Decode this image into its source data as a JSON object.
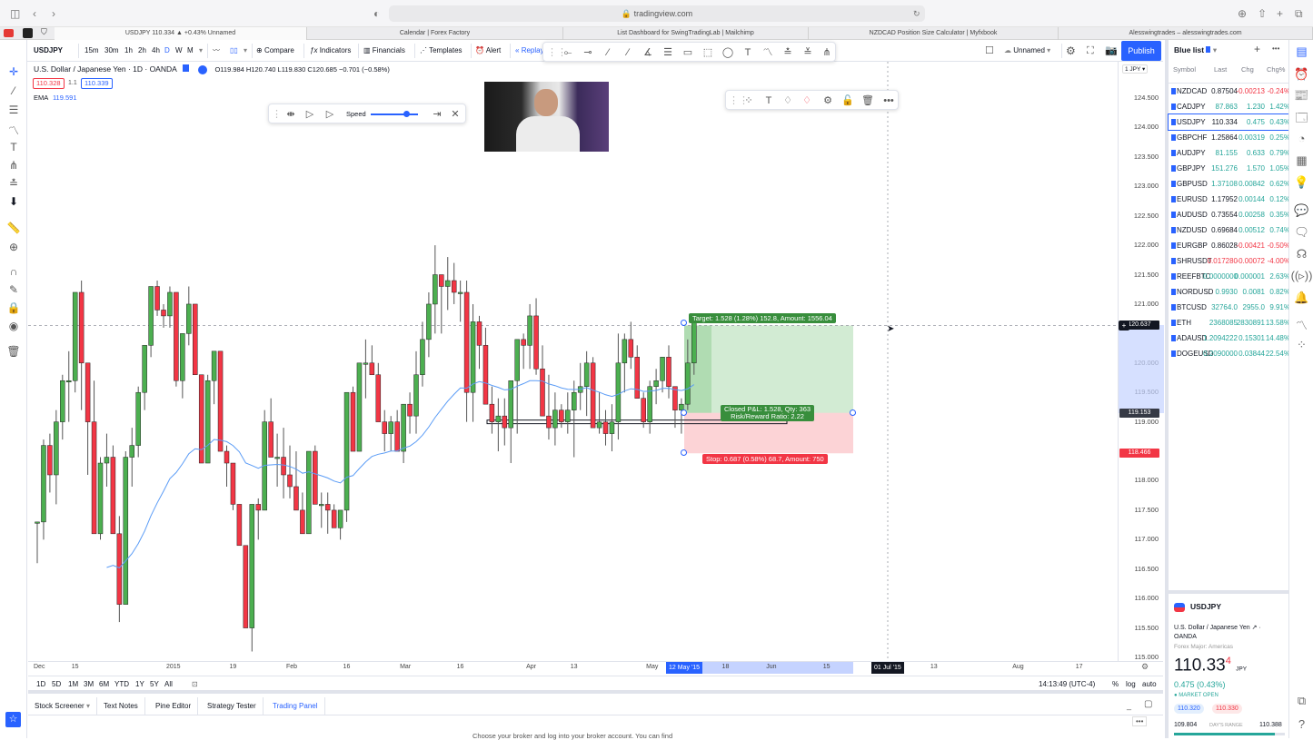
{
  "browser": {
    "url": "tradingview.com",
    "tabs": [
      {
        "label": "USDJPY 110.334 ▲ +0.43% Unnamed",
        "active": true
      },
      {
        "label": "Calendar | Forex Factory",
        "active": false
      },
      {
        "label": "List Dashboard for SwingTradingLab | Mailchimp",
        "active": false
      },
      {
        "label": "NZDCAD Position Size Calculator | Myfxbook",
        "active": false
      },
      {
        "label": "Alesswingtrades – alesswingtrades.com",
        "active": false
      }
    ]
  },
  "toolbar": {
    "symbol": "USDJPY",
    "intervals": [
      "15m",
      "30m",
      "1h",
      "2h",
      "4h",
      "D",
      "W",
      "M"
    ],
    "active_interval": "D",
    "compare": "Compare",
    "indicators": "Indicators",
    "financials": "Financials",
    "templates": "Templates",
    "alert": "Alert",
    "replay": "Replay",
    "layout_name": "Unnamed",
    "publish": "Publish"
  },
  "legend": {
    "title": "U.S. Dollar / Japanese Yen · 1D · OANDA",
    "ohlc": "O119.984 H120.740 L119.830 C120.685 −0.701 (−0.58%)",
    "bid": "110.328",
    "spread": "1.1",
    "ask": "110.339",
    "ema_label": "EMA",
    "ema_value": "119.591"
  },
  "replay_bar": {
    "speed_label": "Speed",
    "speed": 0.75
  },
  "position_tool": {
    "target_label": "Target: 1.528 (1.28%) 152.8, Amount: 1556.04",
    "closed_label_1": "Closed P&L: 1.528, Qty: 363",
    "closed_label_2": "Risk/Reward Ratio: 2.22",
    "stop_label": "Stop: 0.687 (0.58%) 68.7, Amount: 750"
  },
  "chart_data": {
    "type": "candlestick",
    "title": "USDJPY · 1D · OANDA",
    "ylim": [
      115.0,
      124.75
    ],
    "y_ticks": [
      "124.500",
      "124.000",
      "123.500",
      "123.000",
      "122.500",
      "122.000",
      "121.500",
      "121.000",
      "120.000",
      "119.500",
      "119.000",
      "118.000",
      "117.500",
      "117.000",
      "116.500",
      "116.000",
      "115.500",
      "115.000"
    ],
    "y_tick_values": [
      124.5,
      124.0,
      123.5,
      123.0,
      122.5,
      122.0,
      121.5,
      121.0,
      120.0,
      119.5,
      119.0,
      118.0,
      117.5,
      117.0,
      116.5,
      116.0,
      115.5,
      115.0
    ],
    "price_badges": [
      {
        "value": "120.637",
        "color": "#131722"
      },
      {
        "value": "119.153",
        "color": "#363a45"
      },
      {
        "value": "118.466",
        "color": "#f23645"
      }
    ],
    "currency_label": "1 JPY ▾",
    "x_ticks": [
      "Dec",
      "15",
      "2015",
      "19",
      "Feb",
      "16",
      "Mar",
      "16",
      "Apr",
      "13",
      "May",
      "18",
      "Jun",
      "15",
      "13",
      "Aug",
      "17"
    ],
    "x_tick_index": [
      0,
      6,
      21,
      31,
      40,
      49,
      58,
      67,
      78,
      85,
      97,
      109,
      116,
      125,
      142,
      155,
      165
    ],
    "x_highlight_start": "12 May '15",
    "x_highlight_end": "01 Jul '15",
    "candles": [
      [
        117.3,
        117.3,
        116.6,
        117.3
      ],
      [
        117.3,
        118.7,
        117.0,
        118.6
      ],
      [
        118.6,
        118.8,
        117.8,
        118.1
      ],
      [
        118.1,
        119.2,
        117.6,
        119.0
      ],
      [
        119.0,
        119.8,
        118.7,
        119.7
      ],
      [
        119.7,
        120.2,
        119.0,
        119.7
      ],
      [
        119.7,
        121.1,
        119.5,
        121.2
      ],
      [
        121.2,
        121.4,
        119.2,
        120.0
      ],
      [
        120.0,
        119.5,
        118.1,
        119.0
      ],
      [
        119.0,
        119.7,
        117.4,
        117.1
      ],
      [
        117.1,
        118.4,
        117.0,
        118.3
      ],
      [
        118.3,
        118.8,
        117.9,
        118.4
      ],
      [
        118.4,
        118.6,
        117.1,
        117.1
      ],
      [
        117.1,
        117.4,
        115.6,
        115.9
      ],
      [
        115.9,
        118.5,
        115.9,
        118.4
      ],
      [
        118.4,
        118.9,
        117.9,
        118.6
      ],
      [
        118.6,
        119.6,
        118.4,
        119.5
      ],
      [
        119.5,
        120.2,
        119.2,
        120.3
      ],
      [
        120.3,
        121.0,
        120.1,
        121.3
      ],
      [
        121.3,
        121.4,
        120.8,
        120.9
      ],
      [
        120.9,
        121.0,
        120.6,
        120.8
      ],
      [
        120.8,
        121.3,
        120.6,
        121.2
      ],
      [
        121.2,
        121.2,
        119.6,
        119.7
      ],
      [
        119.7,
        120.5,
        119.4,
        120.5
      ],
      [
        120.5,
        121.3,
        120.3,
        121.0
      ],
      [
        121.0,
        121.0,
        119.8,
        119.8
      ],
      [
        119.8,
        119.8,
        118.4,
        118.3
      ],
      [
        118.3,
        119.8,
        118.3,
        119.7
      ],
      [
        119.7,
        120.2,
        119.3,
        120.2
      ],
      [
        120.2,
        120.2,
        118.5,
        118.5
      ],
      [
        118.5,
        118.6,
        117.9,
        118.3
      ],
      [
        118.3,
        118.3,
        117.5,
        117.6
      ],
      [
        117.6,
        117.6,
        116.9,
        116.9
      ],
      [
        116.9,
        116.9,
        115.6,
        115.5
      ],
      [
        115.5,
        117.5,
        115.1,
        117.6
      ],
      [
        117.6,
        117.7,
        117.0,
        117.5
      ],
      [
        117.5,
        119.2,
        117.5,
        119.0
      ],
      [
        119.0,
        119.4,
        118.6,
        118.4
      ],
      [
        118.4,
        118.8,
        117.9,
        118.4
      ],
      [
        118.4,
        118.9,
        117.7,
        118.1
      ],
      [
        118.1,
        118.6,
        117.7,
        117.9
      ],
      [
        117.9,
        118.5,
        117.5,
        117.5
      ],
      [
        117.5,
        117.8,
        117.3,
        117.1
      ],
      [
        117.1,
        118.4,
        117.3,
        118.5
      ],
      [
        118.5,
        118.6,
        117.9,
        117.6
      ],
      [
        117.6,
        117.8,
        117.2,
        117.6
      ],
      [
        117.6,
        117.8,
        117.1,
        117.5
      ],
      [
        117.5,
        117.6,
        117.3,
        117.2
      ],
      [
        117.2,
        117.4,
        117.0,
        117.5
      ],
      [
        117.5,
        119.5,
        117.3,
        119.5
      ],
      [
        119.5,
        119.6,
        118.6,
        118.5
      ],
      [
        118.5,
        120.0,
        118.5,
        120.0
      ],
      [
        120.0,
        120.4,
        119.4,
        120.0
      ],
      [
        120.0,
        120.3,
        119.8,
        119.8
      ],
      [
        119.8,
        120.0,
        119.3,
        119.0
      ],
      [
        119.0,
        119.2,
        118.5,
        118.8
      ],
      [
        118.8,
        119.1,
        118.5,
        119.0
      ],
      [
        119.0,
        119.2,
        118.7,
        118.5
      ],
      [
        118.5,
        119.2,
        118.3,
        119.3
      ],
      [
        119.3,
        119.5,
        118.8,
        119.1
      ],
      [
        119.1,
        120.2,
        118.8,
        119.8
      ],
      [
        119.8,
        120.7,
        119.6,
        120.4
      ],
      [
        120.4,
        121.2,
        120.1,
        121.0
      ],
      [
        121.0,
        122.0,
        120.5,
        121.5
      ],
      [
        121.5,
        121.5,
        120.5,
        121.3
      ],
      [
        121.3,
        121.8,
        120.9,
        121.4
      ],
      [
        121.4,
        121.7,
        121.0,
        121.2
      ],
      [
        121.2,
        121.4,
        120.7,
        121.2
      ],
      [
        121.2,
        121.4,
        119.0,
        119.5
      ],
      [
        119.5,
        121.0,
        119.0,
        120.7
      ],
      [
        120.7,
        120.8,
        119.9,
        120.3
      ],
      [
        120.3,
        120.6,
        119.5,
        119.3
      ],
      [
        119.3,
        119.6,
        118.8,
        119.0
      ],
      [
        119.0,
        119.4,
        118.5,
        119.1
      ],
      [
        119.1,
        119.4,
        118.6,
        118.9
      ],
      [
        118.9,
        119.1,
        118.3,
        119.7
      ],
      [
        119.7,
        119.9,
        118.8,
        120.4
      ],
      [
        120.4,
        120.5,
        119.9,
        120.3
      ],
      [
        120.3,
        121.0,
        119.9,
        120.8
      ],
      [
        120.8,
        121.1,
        119.8,
        119.9
      ],
      [
        119.9,
        120.3,
        119.5,
        119.1
      ],
      [
        119.1,
        119.8,
        118.7,
        118.9
      ],
      [
        118.9,
        119.5,
        118.6,
        119.2
      ],
      [
        119.2,
        119.3,
        118.9,
        119.0
      ],
      [
        119.0,
        119.5,
        118.8,
        119.2
      ],
      [
        119.2,
        119.7,
        118.4,
        119.5
      ],
      [
        119.5,
        120.0,
        119.2,
        119.6
      ],
      [
        119.6,
        120.2,
        119.1,
        120.0
      ],
      [
        120.0,
        120.1,
        119.5,
        118.9
      ],
      [
        118.9,
        119.5,
        118.8,
        119.0
      ],
      [
        119.0,
        119.2,
        118.6,
        118.8
      ],
      [
        118.8,
        119.3,
        118.5,
        119.0
      ],
      [
        119.0,
        120.5,
        118.7,
        120.0
      ],
      [
        120.0,
        120.5,
        119.5,
        120.4
      ],
      [
        120.4,
        120.7,
        119.9,
        120.1
      ],
      [
        120.1,
        120.3,
        119.4,
        119.4
      ],
      [
        119.4,
        119.5,
        118.9,
        119.0
      ],
      [
        119.0,
        119.7,
        118.8,
        119.6
      ],
      [
        119.6,
        119.9,
        119.3,
        119.7
      ],
      [
        119.7,
        120.1,
        119.5,
        120.1
      ],
      [
        120.1,
        120.3,
        119.4,
        119.6
      ],
      [
        119.6,
        119.6,
        118.9,
        119.2
      ],
      [
        119.2,
        119.4,
        118.8,
        119.3
      ],
      [
        119.3,
        120.4,
        119.2,
        120.0
      ],
      [
        120.0,
        120.7,
        119.8,
        120.7
      ]
    ],
    "ema_color": "#5b9cf6",
    "up_color": "#4caf50",
    "down_color": "#f23645"
  },
  "timebar": {
    "ranges": [
      "1D",
      "5D",
      "1M",
      "3M",
      "6M",
      "YTD",
      "1Y",
      "5Y",
      "All"
    ],
    "clock": "14:13:49 (UTC-4)",
    "pct": "%",
    "log": "log",
    "auto": "auto"
  },
  "bottom_tabs": [
    "Stock Screener",
    "Text Notes",
    "Pine Editor",
    "Strategy Tester",
    "Trading Panel"
  ],
  "bottom_active": "Trading Panel",
  "bottom_message": "Choose your broker and log into your broker account. You can find",
  "watchlist": {
    "title": "Blue list",
    "columns": [
      "Symbol",
      "Last",
      "Chg",
      "Chg%"
    ],
    "rows": [
      {
        "symbol": "NZDCAD",
        "last": "0.87504",
        "chg": "-0.00213",
        "chgp": "-0.24%",
        "dir": "dn",
        "lastdir": "flat"
      },
      {
        "symbol": "CADJPY",
        "last": "87.863",
        "chg": "1.230",
        "chgp": "1.42%",
        "dir": "up",
        "lastdir": "up"
      },
      {
        "symbol": "USDJPY",
        "last": "110.334",
        "chg": "0.475",
        "chgp": "0.43%",
        "dir": "up",
        "lastdir": "flat",
        "selected": true
      },
      {
        "symbol": "GBPCHF",
        "last": "1.25864",
        "chg": "0.00319",
        "chgp": "0.25%",
        "dir": "up",
        "lastdir": "flat"
      },
      {
        "symbol": "AUDJPY",
        "last": "81.155",
        "chg": "0.633",
        "chgp": "0.79%",
        "dir": "up",
        "lastdir": "up"
      },
      {
        "symbol": "GBPJPY",
        "last": "151.276",
        "chg": "1.570",
        "chgp": "1.05%",
        "dir": "up",
        "lastdir": "up"
      },
      {
        "symbol": "GBPUSD",
        "last": "1.37108",
        "chg": "0.00842",
        "chgp": "0.62%",
        "dir": "up",
        "lastdir": "up"
      },
      {
        "symbol": "EURUSD",
        "last": "1.17952",
        "chg": "0.00144",
        "chgp": "0.12%",
        "dir": "up",
        "lastdir": "flat"
      },
      {
        "symbol": "AUDUSD",
        "last": "0.73554",
        "chg": "0.00258",
        "chgp": "0.35%",
        "dir": "up",
        "lastdir": "flat"
      },
      {
        "symbol": "NZDUSD",
        "last": "0.69684",
        "chg": "0.00512",
        "chgp": "0.74%",
        "dir": "up",
        "lastdir": "flat"
      },
      {
        "symbol": "EURGBP",
        "last": "0.86028",
        "chg": "-0.00421",
        "chgp": "-0.50%",
        "dir": "dn",
        "lastdir": "flat"
      },
      {
        "symbol": "SHRUSDT",
        "last": "0.017280",
        "chg": "-0.00072",
        "chgp": "-4.00%",
        "dir": "dn",
        "lastdir": "dn"
      },
      {
        "symbol": "REEFBTC",
        "last": "0.0000000",
        "chg": "0.000001",
        "chgp": "2.63%",
        "dir": "up",
        "lastdir": "up"
      },
      {
        "symbol": "NORDUSD",
        "last": "0.9930",
        "chg": "0.0081",
        "chgp": "0.82%",
        "dir": "up",
        "lastdir": "up"
      },
      {
        "symbol": "BTCUSD",
        "last": "32764.0",
        "chg": "2955.0",
        "chgp": "9.91%",
        "dir": "up",
        "lastdir": "up"
      },
      {
        "symbol": "ETH",
        "last": "2368085",
        "chg": "2830891",
        "chgp": "13.58%",
        "dir": "up",
        "lastdir": "up"
      },
      {
        "symbol": "ADAUSD",
        "last": "1.2094222",
        "chg": "0.15301",
        "chgp": "14.48%",
        "dir": "up",
        "lastdir": "up"
      },
      {
        "symbol": "DOGEUSD",
        "last": "0.2090000",
        "chg": "0.03844",
        "chgp": "22.54%",
        "dir": "up",
        "lastdir": "up"
      }
    ]
  },
  "details": {
    "symbol": "USDJPY",
    "name": "U.S. Dollar / Japanese Yen ↗ · OANDA",
    "category": "Forex Major: Americas",
    "price_main": "110.33",
    "price_sup": "4",
    "currency": "JPY",
    "change": "0.475 (0.43%)",
    "status": "● MARKET OPEN",
    "bid": "110.320",
    "ask": "110.330",
    "day_low": "109.804",
    "day_range_label": "DAY'S RANGE",
    "day_high": "110.388",
    "day_range_position": 0.91
  }
}
